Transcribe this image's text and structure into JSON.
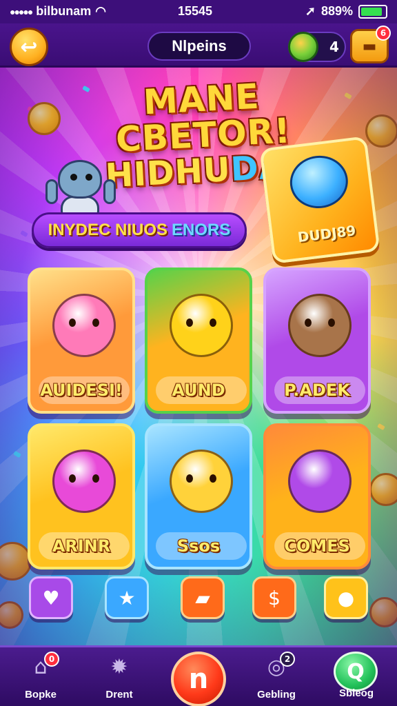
{
  "status_bar": {
    "carrier": "bilbunam",
    "time": "15545",
    "battery_text": "889%",
    "battery_level": 0.89
  },
  "header": {
    "back_icon": "back-arrow-icon",
    "title": "Nlpeins",
    "gem_count": "4",
    "chest_badge": "6"
  },
  "hero": {
    "title_line1": "MANE CBETOR!",
    "title_line2_a": "HIDHU",
    "title_line2_b": "DA?",
    "subtitle_a": "INYDEC NIUOS",
    "subtitle_b": "ENORS",
    "feature_label": "DUDJ89"
  },
  "tiles": [
    {
      "label": "AUIDESI!",
      "bg": "#ff9a3a",
      "border": "#ffe08a",
      "char_color": "#ff7ab8"
    },
    {
      "label": "AUND",
      "bg": "#ffb31f",
      "border": "#57d24a",
      "char_color": "#ffd21a"
    },
    {
      "label": "P.ADEK",
      "bg": "#b04ae8",
      "border": "#d6a4ff",
      "char_color": "#a8744a"
    },
    {
      "label": "ARINR",
      "bg": "#ffc21f",
      "border": "#ffe86a",
      "char_color": "#e84ad8"
    },
    {
      "label": "Ssos",
      "bg": "#3aa8ff",
      "border": "#a8e4ff",
      "char_color": "#ffd23a"
    },
    {
      "label": "COMES",
      "bg": "#ffb21a",
      "border": "#ff8a3a",
      "char_color": "#b04ae8"
    }
  ],
  "quick_icons": [
    {
      "name": "heart-icon",
      "glyph": "♥",
      "bg": "#a84ae8",
      "border": "#e0b4ff"
    },
    {
      "name": "star-icon",
      "glyph": "★",
      "bg": "#3aa8ff",
      "border": "#a8e4ff"
    },
    {
      "name": "gold-bars-icon",
      "glyph": "▰",
      "bg": "#ff6a1a",
      "border": "#ffd08a"
    },
    {
      "name": "dollar-coin-icon",
      "glyph": "$",
      "bg": "#ff6a1a",
      "border": "#ffd08a"
    },
    {
      "name": "reward-icon",
      "glyph": "●",
      "bg": "#ffc21a",
      "border": "#fff0a0"
    }
  ],
  "tabbar": {
    "home_label": "Bopke",
    "home_badge": "0",
    "drent_label": "Drent",
    "center_glyph": "n",
    "settings_label": "Gebling",
    "settings_badge": "2",
    "social_label": "Sbleog"
  }
}
